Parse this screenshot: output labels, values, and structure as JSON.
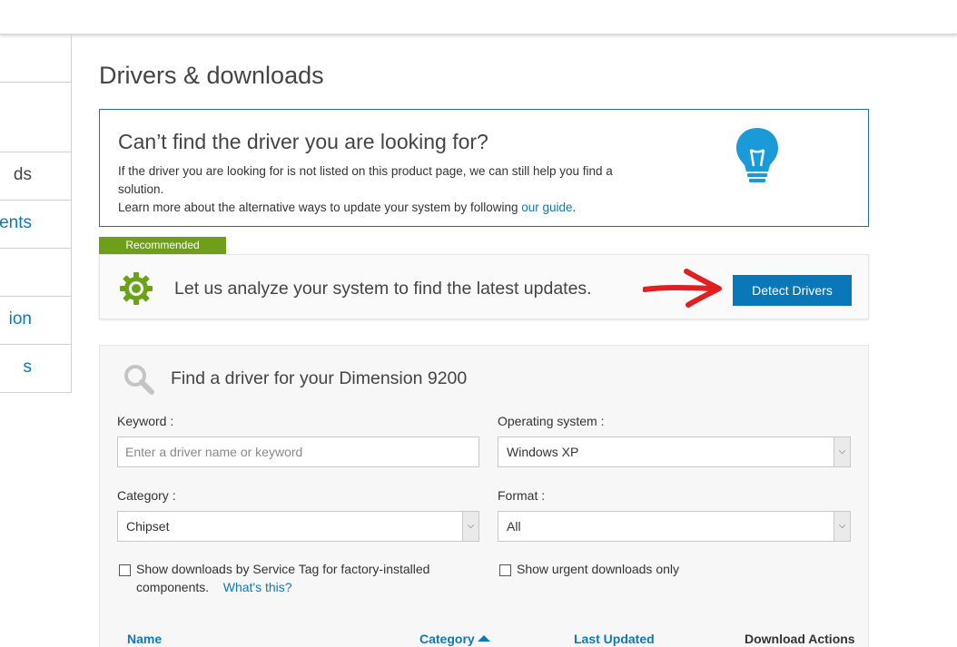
{
  "sidebar": {
    "items": [
      {
        "label": ""
      },
      {
        "label": ""
      },
      {
        "label": "ds"
      },
      {
        "label": "ents"
      },
      {
        "label": ""
      },
      {
        "label": "ion"
      },
      {
        "label": "s"
      }
    ]
  },
  "page_title": "Drivers & downloads",
  "info_box": {
    "heading": "Can’t find the driver you are looking for?",
    "line1": "If the driver you are looking for is not listed on this product page, we can still help you find a solution.",
    "line2_prefix": "Learn more about the alternative ways to update your system by following ",
    "guide_link": "our guide",
    "line2_suffix": ".",
    "icon": "lightbulb-icon"
  },
  "recommended": {
    "tag": "Recommended",
    "text": "Let us analyze your system to find the latest updates.",
    "button": "Detect Drivers",
    "icon": "gear-icon"
  },
  "finder": {
    "title": "Find a driver for your Dimension 9200",
    "keyword_label": "Keyword  :",
    "keyword_placeholder": "Enter a driver name or keyword",
    "os_label": "Operating system :",
    "os_value": "Windows XP",
    "category_label": "Category :",
    "category_value": "Chipset",
    "format_label": "Format :",
    "format_value": "All",
    "servicetag_label": "Show downloads by Service Tag for factory-installed components.",
    "whats_this": "What's this?",
    "urgent_label": "Show urgent downloads only"
  },
  "table": {
    "col_name": "Name",
    "col_category": "Category",
    "col_updated": "Last Updated",
    "col_actions": "Download Actions"
  },
  "colors": {
    "accent": "#0d79b5",
    "button": "#0a77b8",
    "recommended": "#6e9e1a",
    "arrow": "#e02020"
  }
}
